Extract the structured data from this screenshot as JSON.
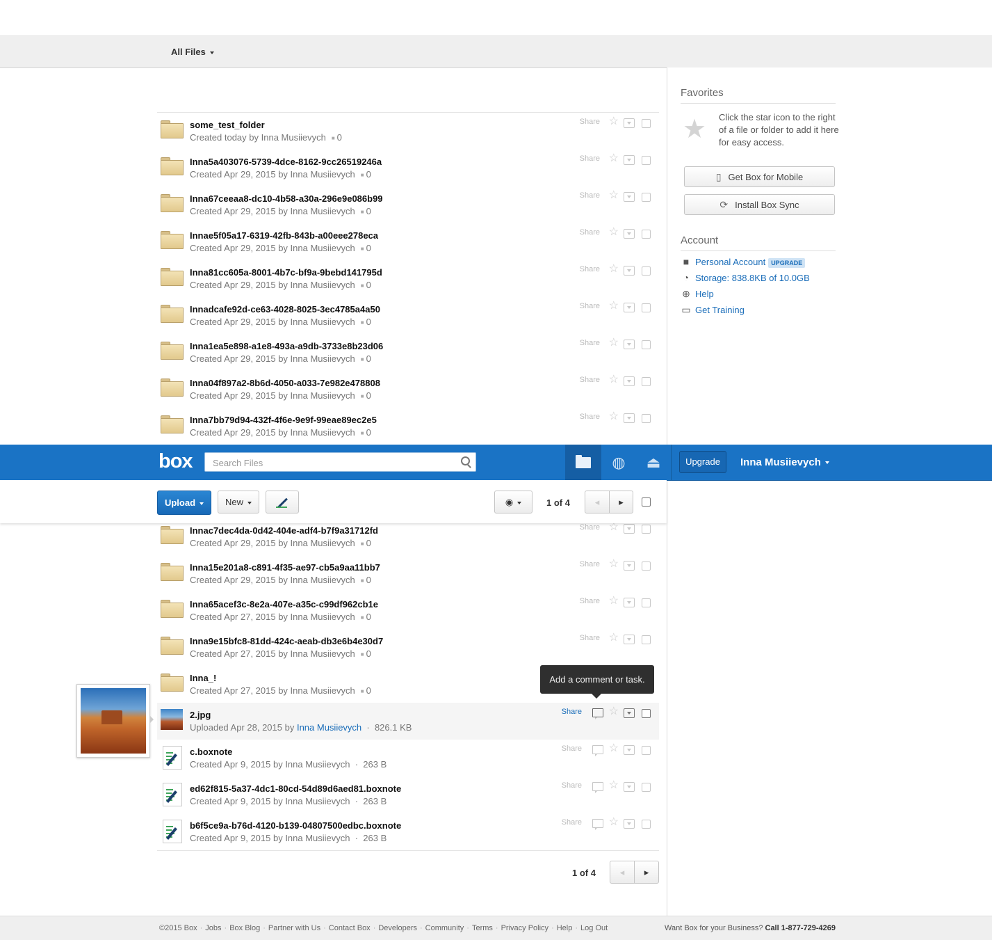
{
  "breadcrumb": {
    "label": "All Files"
  },
  "header": {
    "logo": "box",
    "search_placeholder": "Search Files",
    "upgrade_label": "Upgrade",
    "user_name": "Inna Musiievych"
  },
  "toolbar": {
    "upload_label": "Upload",
    "new_label": "New",
    "page_label": "1 of 4"
  },
  "sidebar": {
    "favorites_title": "Favorites",
    "favorites_text": "Click the star icon to the right of a file or folder to add it here for easy access.",
    "mobile_button": "Get Box for Mobile",
    "sync_button": "Install Box Sync",
    "account_title": "Account",
    "personal_account": "Personal Account",
    "upgrade_badge": "UPGRADE",
    "storage": "Storage: 838.8KB of 10.0GB",
    "help": "Help",
    "training": "Get Training"
  },
  "share_label": "Share",
  "rows_top": [
    {
      "type": "folder",
      "name": "some_test_folder",
      "meta": "Created today by Inna Musiievych",
      "count": "0"
    },
    {
      "type": "folder",
      "name": "Inna5a403076-5739-4dce-8162-9cc26519246a",
      "meta": "Created Apr 29, 2015 by Inna Musiievych",
      "count": "0"
    },
    {
      "type": "folder",
      "name": "Inna67ceeaa8-dc10-4b58-a30a-296e9e086b99",
      "meta": "Created Apr 29, 2015 by Inna Musiievych",
      "count": "0"
    },
    {
      "type": "folder",
      "name": "Innae5f05a17-6319-42fb-843b-a00eee278eca",
      "meta": "Created Apr 29, 2015 by Inna Musiievych",
      "count": "0"
    },
    {
      "type": "folder",
      "name": "Inna81cc605a-8001-4b7c-bf9a-9bebd141795d",
      "meta": "Created Apr 29, 2015 by Inna Musiievych",
      "count": "0"
    },
    {
      "type": "folder",
      "name": "Innadcafe92d-ce63-4028-8025-3ec4785a4a50",
      "meta": "Created Apr 29, 2015 by Inna Musiievych",
      "count": "0"
    },
    {
      "type": "folder",
      "name": "Inna1ea5e898-a1e8-493a-a9db-3733e8b23d06",
      "meta": "Created Apr 29, 2015 by Inna Musiievych",
      "count": "0"
    },
    {
      "type": "folder",
      "name": "Inna04f897a2-8b6d-4050-a033-7e982e478808",
      "meta": "Created Apr 29, 2015 by Inna Musiievych",
      "count": "0"
    },
    {
      "type": "folder",
      "name": "Inna7bb79d94-432f-4f6e-9e9f-99eae89ec2e5",
      "meta": "Created Apr 29, 2015 by Inna Musiievych",
      "count": "0"
    }
  ],
  "rows_bottom": [
    {
      "type": "folder",
      "name": "Innac7dec4da-0d42-404e-adf4-b7f9a31712fd",
      "meta": "Created Apr 29, 2015 by Inna Musiievych",
      "count": "0"
    },
    {
      "type": "folder",
      "name": "Inna15e201a8-c891-4f35-ae97-cb5a9aa11bb7",
      "meta": "Created Apr 29, 2015 by Inna Musiievych",
      "count": "0"
    },
    {
      "type": "folder",
      "name": "Inna65acef3c-8e2a-407e-a35c-c99df962cb1e",
      "meta": "Created Apr 27, 2015 by Inna Musiievych",
      "count": "0"
    },
    {
      "type": "folder",
      "name": "Inna9e15bfc8-81dd-424c-aeab-db3e6b4e30d7",
      "meta": "Created Apr 27, 2015 by Inna Musiievych",
      "count": "0"
    },
    {
      "type": "folder",
      "name": "Inna_!",
      "meta": "Created Apr 27, 2015 by Inna Musiievych",
      "count": "0"
    },
    {
      "type": "image",
      "name": "2.jpg",
      "meta_prefix": "Uploaded Apr 28, 2015 by ",
      "meta_user": "Inna Musiievych",
      "size": "826.1 KB",
      "hover": true
    },
    {
      "type": "note",
      "name": "c.boxnote",
      "meta": "Created Apr 9, 2015 by Inna Musiievych",
      "size": "263 B"
    },
    {
      "type": "note",
      "name": "ed62f815-5a37-4dc1-80cd-54d89d6aed81.boxnote",
      "meta": "Created Apr 9, 2015 by Inna Musiievych",
      "size": "263 B"
    },
    {
      "type": "note",
      "name": "b6f5ce9a-b76d-4120-b139-04807500edbc.boxnote",
      "meta": "Created Apr 9, 2015 by Inna Musiievych",
      "size": "263 B"
    }
  ],
  "tooltip": "Add a comment or task.",
  "bottom_pagination": "1 of 4",
  "footer": {
    "links": [
      "©2015 Box",
      "Jobs",
      "Box Blog",
      "Partner with Us",
      "Contact Box",
      "Developers",
      "Community",
      "Terms",
      "Privacy Policy",
      "Help",
      "Log Out"
    ],
    "business_text": "Want Box for your Business?",
    "phone": "Call 1-877-729-4269"
  },
  "icons": {
    "search": "search-icon",
    "folder": "folder-icon",
    "globe": "globe-icon",
    "inbox": "inbox-icon",
    "star": "star-icon",
    "comment": "comment-icon",
    "menu": "chevron-down-icon",
    "check": "checkbox"
  }
}
